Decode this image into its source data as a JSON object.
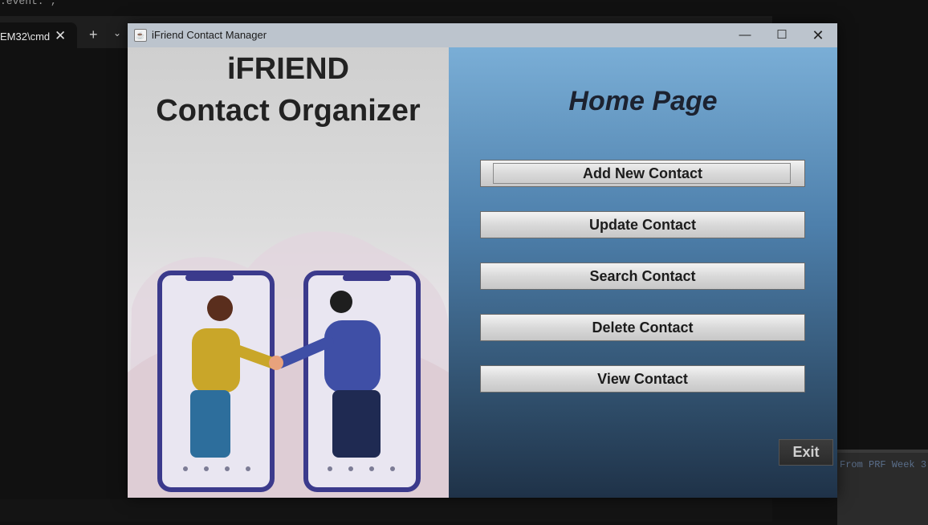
{
  "background": {
    "top_text": ".event.*;",
    "tab_label": "EM32\\cmd",
    "right_snippet": "From PRF Week 3"
  },
  "window": {
    "title": "iFriend Contact Manager",
    "controls": {
      "minimize": "—",
      "maximize": "☐",
      "close": "✕"
    }
  },
  "left": {
    "title_line1": "iFRIEND",
    "title_line2": "Contact Organizer",
    "illustration_icon_names": [
      "person-left",
      "person-right",
      "phone-left",
      "phone-right",
      "handshake"
    ]
  },
  "right": {
    "heading": "Home Page",
    "buttons": [
      "Add New Contact",
      "Update Contact",
      "Search Contact",
      "Delete Contact",
      "View Contact"
    ],
    "exit_label": "Exit"
  },
  "colors": {
    "right_panel_top": "#7aaed6",
    "right_panel_bottom": "#1f3248",
    "title_text": "#222222"
  }
}
